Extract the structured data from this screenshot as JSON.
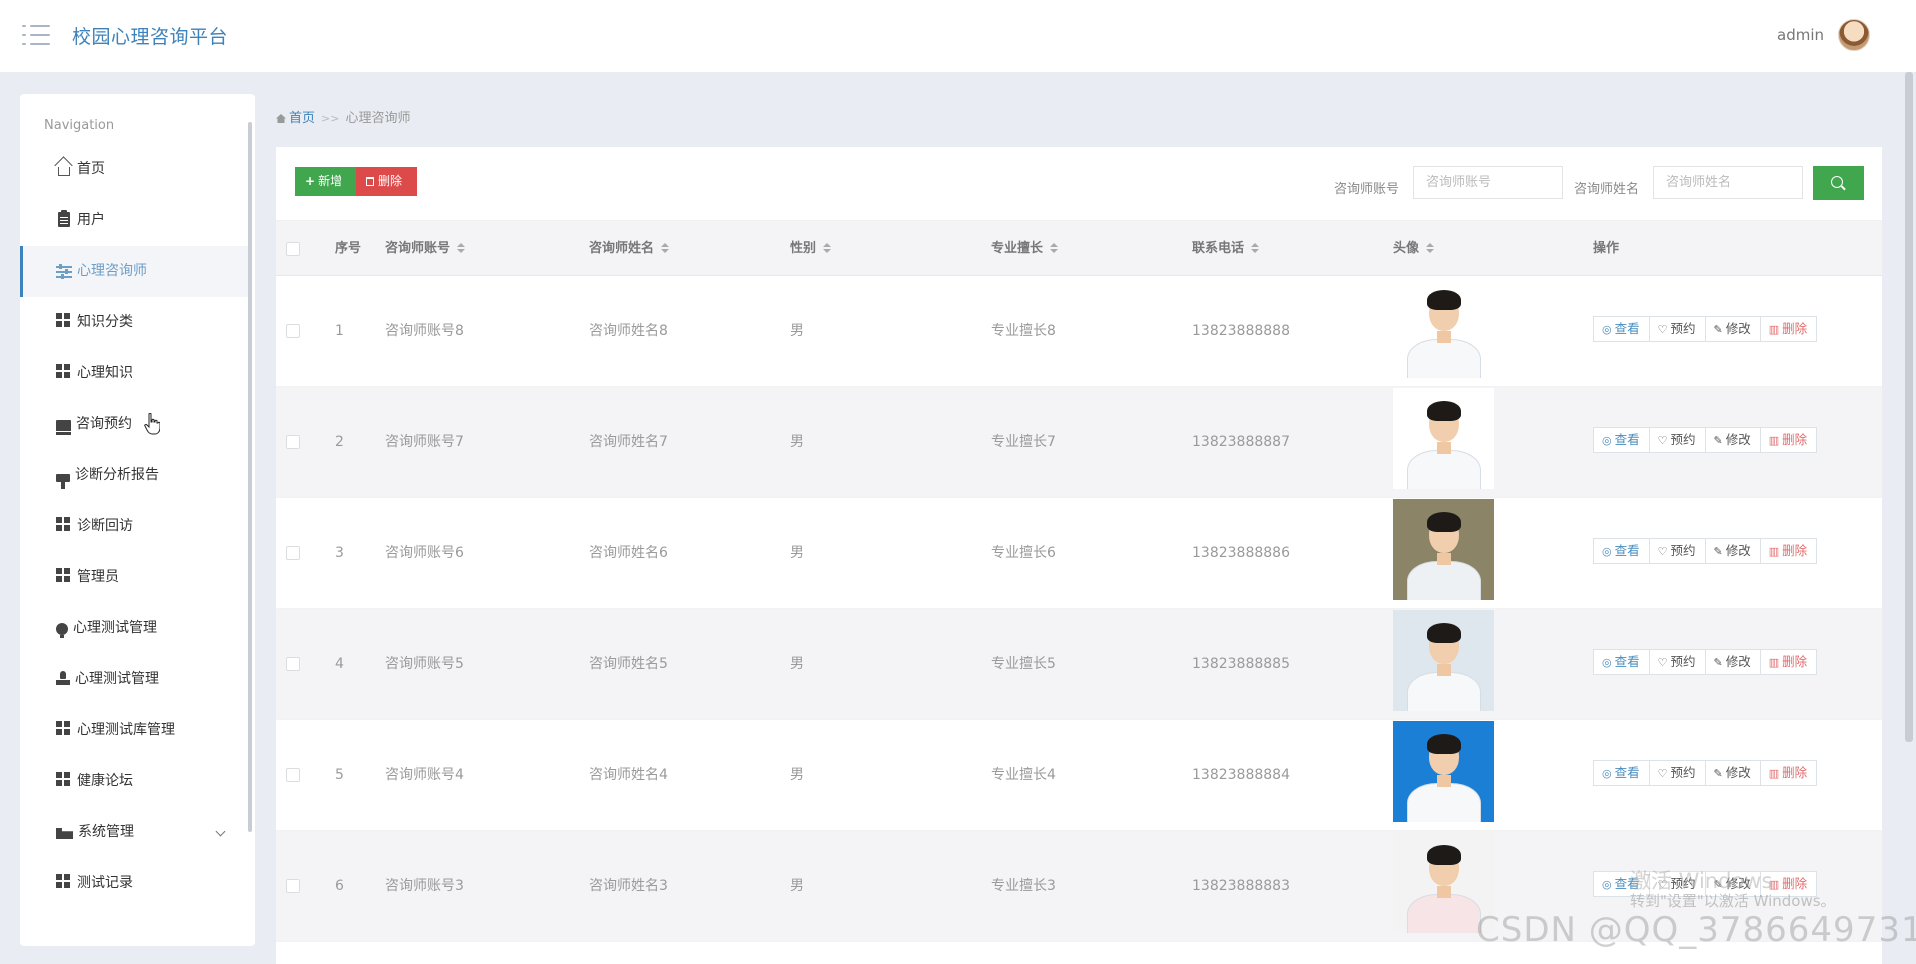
{
  "header": {
    "app_title": "校园心理咨询平台",
    "user_name": "admin"
  },
  "sidebar": {
    "heading": "Navigation",
    "items": [
      {
        "label": "首页",
        "icon": "home-icon"
      },
      {
        "label": "用户",
        "icon": "clipboard-icon"
      },
      {
        "label": "心理咨询师",
        "icon": "sliders-icon",
        "active": true
      },
      {
        "label": "知识分类",
        "icon": "grid-icon"
      },
      {
        "label": "心理知识",
        "icon": "grid-icon"
      },
      {
        "label": "咨询预约",
        "icon": "inbox-icon"
      },
      {
        "label": "诊断分析报告",
        "icon": "paint-brush-icon"
      },
      {
        "label": "诊断回访",
        "icon": "grid-icon"
      },
      {
        "label": "管理员",
        "icon": "grid-icon"
      },
      {
        "label": "心理测试管理",
        "icon": "lightbulb-icon"
      },
      {
        "label": "心理测试管理",
        "icon": "stamp-icon"
      },
      {
        "label": "心理测试库管理",
        "icon": "grid-icon"
      },
      {
        "label": "健康论坛",
        "icon": "grid-icon"
      },
      {
        "label": "系统管理",
        "icon": "ticket-icon",
        "expandable": true
      },
      {
        "label": "测试记录",
        "icon": "grid-icon"
      }
    ]
  },
  "breadcrumb": {
    "home": "首页",
    "separator": ">>",
    "current": "心理咨询师"
  },
  "toolbar": {
    "add_label": "新增",
    "delete_label": "删除",
    "account_label": "咨询师账号",
    "account_placeholder": "咨询师账号",
    "name_label": "咨询师姓名",
    "name_placeholder": "咨询师姓名"
  },
  "table": {
    "columns": [
      "序号",
      "咨询师账号",
      "咨询师姓名",
      "性别",
      "专业擅长",
      "联系电话",
      "头像",
      "操作"
    ],
    "action_labels": {
      "view": "查看",
      "book": "预约",
      "edit": "修改",
      "delete": "删除"
    },
    "rows": [
      {
        "index": "1",
        "account": "咨询师账号8",
        "name": "咨询师姓名8",
        "gender": "男",
        "specialty": "专业擅长8",
        "phone": "13823888888",
        "photo_bg": "#ffffff",
        "coat": "#f6f8fa"
      },
      {
        "index": "2",
        "account": "咨询师账号7",
        "name": "咨询师姓名7",
        "gender": "男",
        "specialty": "专业擅长7",
        "phone": "13823888887",
        "photo_bg": "#ffffff",
        "coat": "#f6f8fa"
      },
      {
        "index": "3",
        "account": "咨询师账号6",
        "name": "咨询师姓名6",
        "gender": "男",
        "specialty": "专业擅长6",
        "phone": "13823888886",
        "photo_bg": "#8c8466",
        "coat": "#eef1f3"
      },
      {
        "index": "4",
        "account": "咨询师账号5",
        "name": "咨询师姓名5",
        "gender": "男",
        "specialty": "专业擅长5",
        "phone": "13823888885",
        "photo_bg": "#dfe7ee",
        "coat": "#f6f8fa"
      },
      {
        "index": "5",
        "account": "咨询师账号4",
        "name": "咨询师姓名4",
        "gender": "男",
        "specialty": "专业擅长4",
        "phone": "13823888884",
        "photo_bg": "#1b7fd6",
        "coat": "#f6f8fa"
      },
      {
        "index": "6",
        "account": "咨询师账号3",
        "name": "咨询师姓名3",
        "gender": "男",
        "specialty": "专业擅长3",
        "phone": "13823888883",
        "photo_bg": "#f3f3f3",
        "coat": "#f7e4e6"
      }
    ]
  },
  "overlays": {
    "windows_line1": "激活 Windows",
    "windows_line2": "转到\"设置\"以激活 Windows。",
    "csdn": "CSDN @QQ_3786649731"
  },
  "colors": {
    "accent": "#3d82ba",
    "add": "#41a74e",
    "danger": "#dc4a4a"
  }
}
